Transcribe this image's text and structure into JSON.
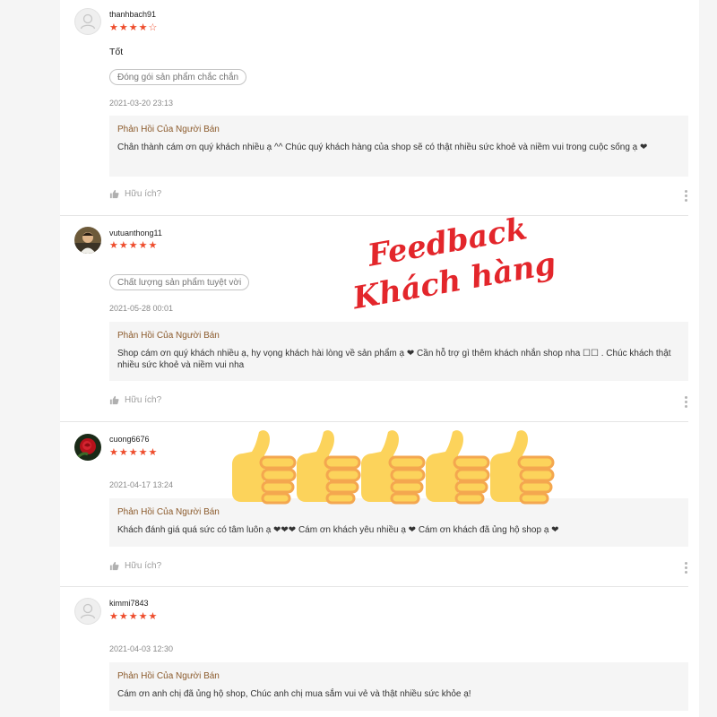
{
  "colors": {
    "star": "#ee4d2d",
    "reply_title": "#8b5a2b",
    "overlay_text": "#e3262b",
    "thumb_fill": "#fcd35b",
    "thumb_stripe": "#f4a74f"
  },
  "overlay": {
    "line1": "Feedback",
    "line2": "Khách hàng",
    "icon": "thumbs-up-emoji",
    "thumbs_count": 5
  },
  "reviews": [
    {
      "username": "thanhbach91",
      "avatar": "default-user-icon",
      "rating": 4,
      "stars_text": "★★★★☆",
      "comment": "Tốt",
      "tag": "Đóng gói sản phẩm chắc chắn",
      "time": "2021-03-20 23:13",
      "reply_title": "Phản Hồi Của Người Bán",
      "reply_text": "Chân thành cám ơn quý khách nhiều ạ ^^ Chúc quý khách hàng của shop sẽ có thật nhiều sức khoẻ và niềm vui trong cuộc sống ạ ❤",
      "helpful": "Hữu ích?"
    },
    {
      "username": "vutuanthong11",
      "avatar": "user-photo-icon",
      "rating": 5,
      "stars_text": "★★★★★",
      "comment": "",
      "tag": "Chất lượng sản phẩm tuyệt vời",
      "time": "2021-05-28 00:01",
      "reply_title": "Phản Hồi Của Người Bán",
      "reply_text": "Shop cám ơn quý khách nhiều ạ, hy vọng khách hài lòng về sản phẩm ạ ❤ Cần hỗ trợ gì thêm khách nhắn shop nha ☐☐ . Chúc khách thật nhiều sức khoẻ và niềm vui nha",
      "helpful": "Hữu ích?"
    },
    {
      "username": "cuong6676",
      "avatar": "rose-avatar-icon",
      "rating": 5,
      "stars_text": "★★★★★",
      "comment": "",
      "tag": "",
      "time": "2021-04-17 13:24",
      "reply_title": "Phản Hồi Của Người Bán",
      "reply_text": " Khách đánh giá quá sức có tâm luôn ạ ❤❤❤ Cám ơn khách yêu nhiều ạ ❤ Cám ơn khách đã ủng hộ shop ạ ❤",
      "helpful": "Hữu ích?"
    },
    {
      "username": "kimmi7843",
      "avatar": "default-user-icon",
      "rating": 5,
      "stars_text": "★★★★★",
      "comment": "",
      "tag": "",
      "time": "2021-04-03 12:30",
      "reply_title": "Phản Hồi Của Người Bán",
      "reply_text": "Cám ơn anh chị đã ủng hộ shop, Chúc anh chị mua sắm vui vẻ và thật nhiều sức khỏe ạ!",
      "helpful": ""
    }
  ]
}
